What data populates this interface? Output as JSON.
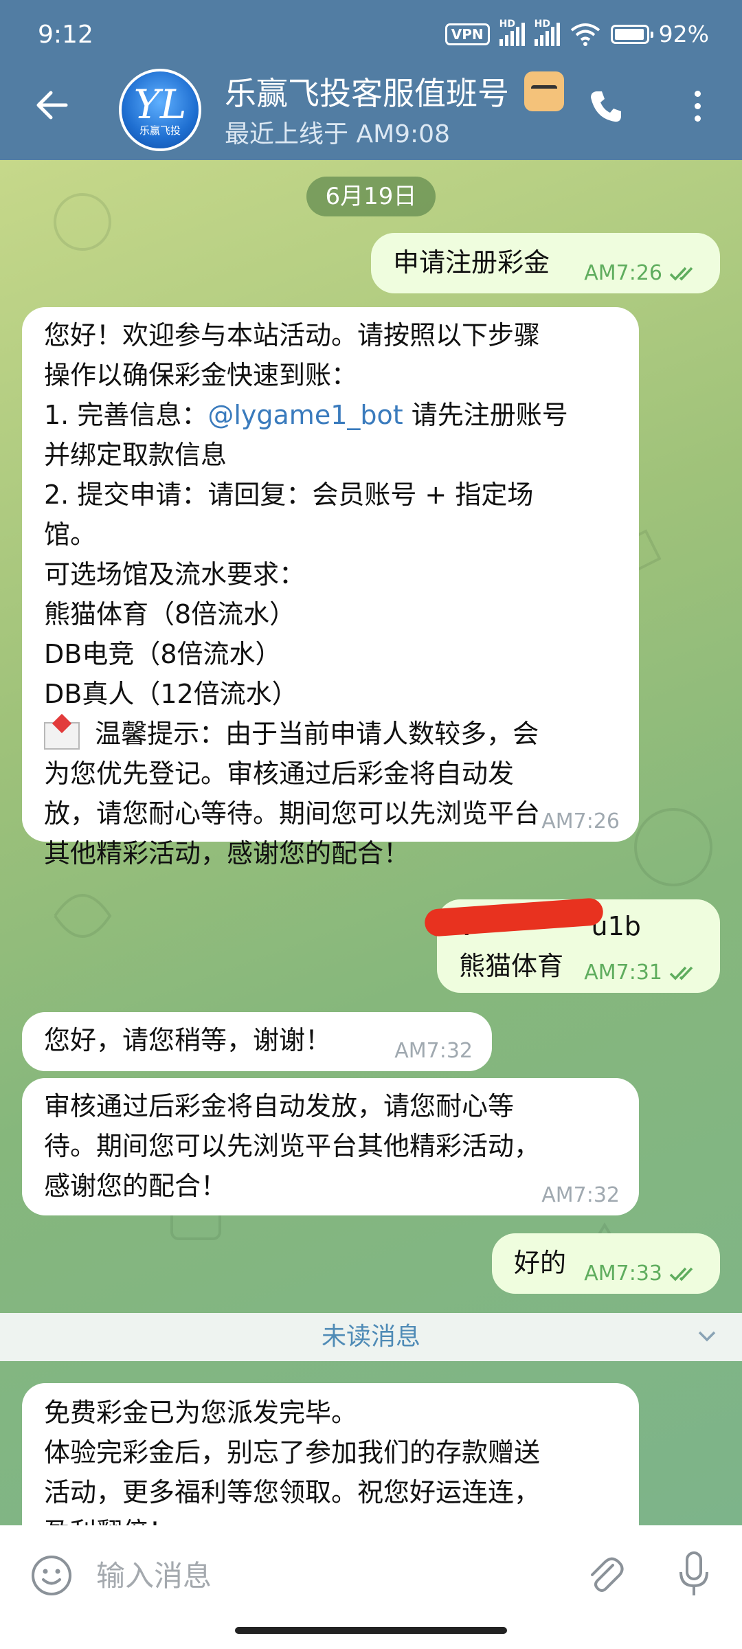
{
  "status_bar": {
    "time": "9:12",
    "vpn": "VPN",
    "hd": "HD",
    "battery": "92%"
  },
  "header": {
    "title": "乐赢飞投客服值班号",
    "subtitle": "最近上线于 AM9:08",
    "avatar_text": "乐赢飞投",
    "avatar_mono": "YL"
  },
  "chat": {
    "date": "6月19日",
    "messages": [
      {
        "dir": "out",
        "lines": [
          "申请注册彩金"
        ],
        "time": "AM7:26"
      },
      {
        "dir": "in",
        "time": "AM7:26",
        "lines": [
          "您好！欢迎参与本站活动。请按照以下步骤",
          "操作以确保彩金快速到账：",
          "1. 完善信息：",
          "@lygame1_bot",
          " 请先注册账号",
          "并绑定取款信息",
          "2. 提交申请：请回复：会员账号 + 指定场",
          "馆。",
          "可选场馆及流水要求：",
          "熊猫体育（8倍流水）",
          "DB电竞（8倍流水）",
          "DB真人（12倍流水）",
          " 温馨提示：由于当前申请人数较多，会",
          "为您优先登记。审核通过后彩金将自动发",
          "放，请您耐心等待。期间您可以先浏览平台",
          "其他精彩活动，感谢您的配合！"
        ]
      },
      {
        "dir": "out",
        "lines": [
          "v",
          "u1b",
          "熊猫体育"
        ],
        "time": "AM7:31"
      },
      {
        "dir": "in",
        "lines": [
          "您好，请您稍等，谢谢！"
        ],
        "time": "AM7:32"
      },
      {
        "dir": "in",
        "time": "AM7:32",
        "lines": [
          "审核通过后彩金将自动发放，请您耐心等",
          "待。期间您可以先浏览平台其他精彩活动，",
          "感谢您的配合！"
        ]
      },
      {
        "dir": "out",
        "lines": [
          "好的"
        ],
        "time": "AM7:33"
      }
    ],
    "unread_label": "未读消息",
    "last_message": [
      "免费彩金已为您派发完毕。",
      "体验完彩金后，别忘了参加我们的存款赠送",
      "活动，更多福利等您领取。祝您好运连连，",
      "盈利翻倍！"
    ]
  },
  "input": {
    "placeholder": "输入消息"
  },
  "colors": {
    "header": "#527da3",
    "out_bubble": "#effdde",
    "in_bubble": "#ffffff",
    "link": "#3a7bbd"
  },
  "icons": [
    "back-arrow-icon",
    "phone-icon",
    "more-icon",
    "double-check-icon",
    "mail-icon",
    "chevron-down-icon",
    "emoji-icon",
    "attach-icon",
    "mic-icon"
  ]
}
